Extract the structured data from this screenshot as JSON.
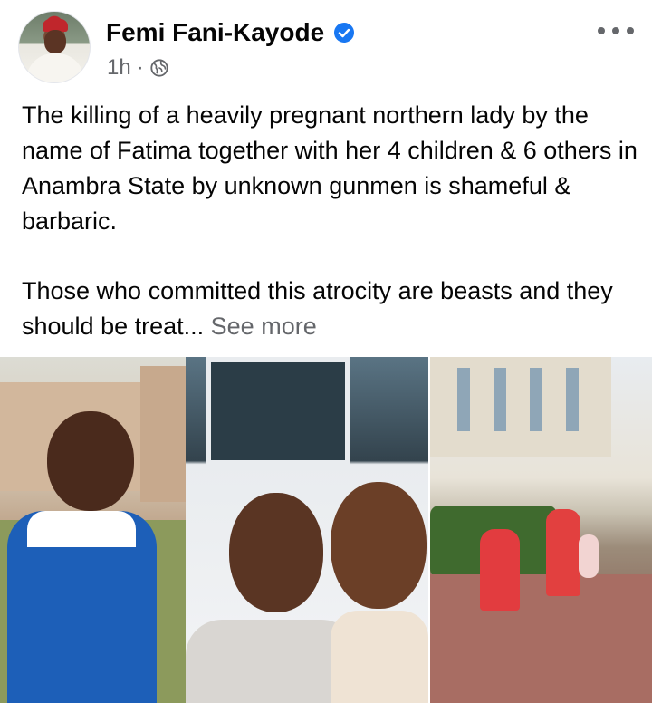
{
  "post": {
    "author": "Femi Fani-Kayode",
    "time": "1h",
    "separator": "·",
    "icons": {
      "verified": "verified-badge-icon",
      "audience": "globe-icon",
      "menu": "more-options-icon"
    },
    "text_paragraph_1": "The killing of a heavily pregnant northern lady by the name of Fatima together with her 4 children & 6 others in Anambra State by unknown gunmen is shameful & barbaric.",
    "text_paragraph_2": "Those who committed this atrocity are beasts and they should be treat...",
    "see_more": "See more"
  },
  "colors": {
    "text": "#050505",
    "secondary": "#65676b",
    "verified": "#1877f2"
  }
}
